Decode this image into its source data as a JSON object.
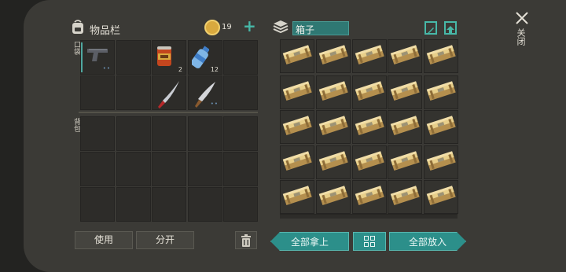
{
  "inventory": {
    "title": "物品栏",
    "pockets_label": "口袋",
    "backpack_label": "背包",
    "coins": "19",
    "add_label": "+",
    "slots": [
      {
        "name": "pistol",
        "qty": ""
      },
      {
        "name": "empty",
        "qty": ""
      },
      {
        "name": "canned-food",
        "qty": "2"
      },
      {
        "name": "water-bottle",
        "qty": "12"
      },
      {
        "name": "empty",
        "qty": ""
      },
      {
        "name": "empty",
        "qty": ""
      },
      {
        "name": "empty",
        "qty": ""
      },
      {
        "name": "machete",
        "qty": ""
      },
      {
        "name": "cleaver",
        "qty": ""
      },
      {
        "name": "empty",
        "qty": ""
      }
    ]
  },
  "actions": {
    "use_label": "使用",
    "split_label": "分开"
  },
  "container": {
    "name": "箱子",
    "take_all_label": "全部拿上",
    "put_all_label": "全部放入",
    "item": "wood-planks",
    "colors": {
      "accent": "#2c8f8a",
      "panel": "#3b3a36"
    }
  },
  "close_label": "关闭"
}
